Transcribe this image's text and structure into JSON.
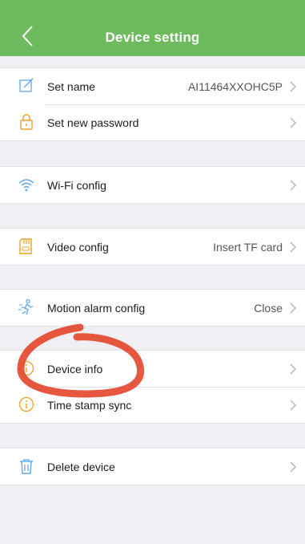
{
  "header": {
    "title": "Device setting",
    "back_icon": "chevron-left-icon"
  },
  "colors": {
    "header": "#6dba5f",
    "icon": "#f0a024",
    "wifi": "#5ca7f0",
    "annotation": "#e5482e"
  },
  "groups": [
    {
      "rows": [
        {
          "icon": "edit-icon",
          "label": "Set name",
          "value": "AI11464XXOHC5P"
        },
        {
          "icon": "lock-icon",
          "label": "Set new password",
          "value": ""
        }
      ]
    },
    {
      "rows": [
        {
          "icon": "wifi-icon",
          "label": "Wi-Fi config",
          "value": ""
        }
      ]
    },
    {
      "rows": [
        {
          "icon": "sd-card-icon",
          "label": "Video config",
          "value": "Insert TF card"
        }
      ]
    },
    {
      "rows": [
        {
          "icon": "motion-icon",
          "label": "Motion alarm config",
          "value": "Close"
        }
      ]
    },
    {
      "rows": [
        {
          "icon": "info-icon",
          "label": "Device info",
          "value": ""
        },
        {
          "icon": "info-icon",
          "label": "Time stamp sync",
          "value": ""
        }
      ]
    },
    {
      "rows": [
        {
          "icon": "trash-icon",
          "label": "Delete device",
          "value": ""
        }
      ]
    }
  ]
}
